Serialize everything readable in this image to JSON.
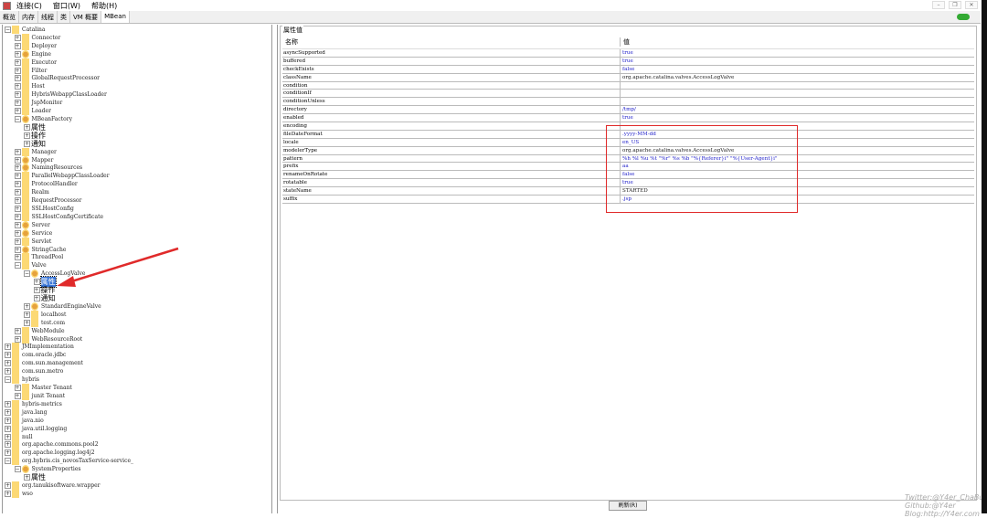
{
  "menu": {
    "items": [
      "连接(C)",
      "窗口(W)",
      "帮助(H)"
    ]
  },
  "window_controls": [
    "minimize",
    "restore",
    "close"
  ],
  "tabs": [
    {
      "label": "概览"
    },
    {
      "label": "内存"
    },
    {
      "label": "线程"
    },
    {
      "label": "类"
    },
    {
      "label": "VM 概要"
    },
    {
      "label": "MBean",
      "active": true
    }
  ],
  "tree": [
    [
      "Catalina",
      0,
      "-",
      "folder"
    ],
    [
      "Connector",
      1,
      "+",
      "folder"
    ],
    [
      "Deployer",
      1,
      "+",
      "folder"
    ],
    [
      "Engine",
      1,
      "+",
      "bean"
    ],
    [
      "Executor",
      1,
      "+",
      "folder"
    ],
    [
      "Filter",
      1,
      "+",
      "folder"
    ],
    [
      "GlobalRequestProcessor",
      1,
      "+",
      "folder"
    ],
    [
      "Host",
      1,
      "+",
      "folder"
    ],
    [
      "HybrisWebappClassLoader",
      1,
      "+",
      "folder"
    ],
    [
      "JspMonitor",
      1,
      "+",
      "folder"
    ],
    [
      "Loader",
      1,
      "+",
      "folder"
    ],
    [
      "MBeanFactory",
      1,
      "-",
      "bean"
    ],
    [
      "属性",
      2,
      "+",
      "none"
    ],
    [
      "操作",
      2,
      "+",
      "none"
    ],
    [
      "通知",
      2,
      "+",
      "none"
    ],
    [
      "Manager",
      1,
      "+",
      "folder"
    ],
    [
      "Mapper",
      1,
      "+",
      "bean"
    ],
    [
      "NamingResources",
      1,
      "+",
      "bean"
    ],
    [
      "ParallelWebappClassLoader",
      1,
      "+",
      "folder"
    ],
    [
      "ProtocolHandler",
      1,
      "+",
      "folder"
    ],
    [
      "Realm",
      1,
      "+",
      "folder"
    ],
    [
      "RequestProcessor",
      1,
      "+",
      "folder"
    ],
    [
      "SSLHostConfig",
      1,
      "+",
      "folder"
    ],
    [
      "SSLHostConfigCertificate",
      1,
      "+",
      "folder"
    ],
    [
      "Server",
      1,
      "+",
      "bean"
    ],
    [
      "Service",
      1,
      "+",
      "bean"
    ],
    [
      "Servlet",
      1,
      "+",
      "folder"
    ],
    [
      "StringCache",
      1,
      "+",
      "bean"
    ],
    [
      "ThreadPool",
      1,
      "+",
      "folder"
    ],
    [
      "Valve",
      1,
      "-",
      "folder"
    ],
    [
      "AccessLogValve",
      2,
      "-",
      "bean"
    ],
    [
      "属性",
      3,
      "+",
      "none",
      "selected"
    ],
    [
      "操作",
      3,
      "+",
      "none"
    ],
    [
      "通知",
      3,
      "+",
      "none"
    ],
    [
      "StandardEngineValve",
      2,
      "+",
      "bean"
    ],
    [
      "localhost",
      2,
      "+",
      "folder"
    ],
    [
      "test.com",
      2,
      "+",
      "folder"
    ],
    [
      "WebModule",
      1,
      "+",
      "folder"
    ],
    [
      "WebResourceRoot",
      1,
      "+",
      "folder"
    ],
    [
      "JMImplementation",
      0,
      "+",
      "folder"
    ],
    [
      "com.oracle.jdbc",
      0,
      "+",
      "folder"
    ],
    [
      "com.sun.management",
      0,
      "+",
      "folder"
    ],
    [
      "com.sun.metro",
      0,
      "+",
      "folder"
    ],
    [
      "hybris",
      0,
      "-",
      "folder"
    ],
    [
      "Master Tenant",
      1,
      "+",
      "folder"
    ],
    [
      "junit Tenant",
      1,
      "+",
      "folder"
    ],
    [
      "hybris-metrics",
      0,
      "+",
      "folder"
    ],
    [
      "java.lang",
      0,
      "+",
      "folder"
    ],
    [
      "java.nio",
      0,
      "+",
      "folder"
    ],
    [
      "java.util.logging",
      0,
      "+",
      "folder"
    ],
    [
      "null",
      0,
      "+",
      "folder"
    ],
    [
      "org.apache.commons.pool2",
      0,
      "+",
      "folder"
    ],
    [
      "org.apache.logging.log4j2",
      0,
      "+",
      "folder"
    ],
    [
      "org.hybris.cis_novosTaxService-service_",
      0,
      "-",
      "folder"
    ],
    [
      "SystemProperties",
      1,
      "-",
      "bean"
    ],
    [
      "属性",
      2,
      "+",
      "none"
    ],
    [
      "org.tanukisoftware.wrapper",
      0,
      "+",
      "folder"
    ],
    [
      "wso",
      0,
      "+",
      "folder"
    ]
  ],
  "attributes": {
    "group_title": "属性值",
    "headers": {
      "name": "名称",
      "value": "值"
    },
    "rows": [
      {
        "name": "asyncSupported",
        "value": "true"
      },
      {
        "name": "buffered",
        "value": "true"
      },
      {
        "name": "checkExists",
        "value": "false"
      },
      {
        "name": "className",
        "value": "org.apache.catalina.valves.AccessLogValve",
        "plain": true
      },
      {
        "name": "condition",
        "value": ""
      },
      {
        "name": "conditionIf",
        "value": ""
      },
      {
        "name": "conditionUnless",
        "value": ""
      },
      {
        "name": "directory",
        "value": "/tmp/"
      },
      {
        "name": "enabled",
        "value": "true"
      },
      {
        "name": "encoding",
        "value": ""
      },
      {
        "name": "fileDateFormat",
        "value": ".yyyy-MM-dd"
      },
      {
        "name": "locale",
        "value": "en_US"
      },
      {
        "name": "modelerType",
        "value": "org.apache.catalina.valves.AccessLogValve",
        "plain": true
      },
      {
        "name": "pattern",
        "value": "%h %l %u %t \"%r\" %s %b \"%{Referer}i\" \"%{User-Agent}i\""
      },
      {
        "name": "prefix",
        "value": "aa"
      },
      {
        "name": "renameOnRotate",
        "value": "false"
      },
      {
        "name": "rotatable",
        "value": "true"
      },
      {
        "name": "stateName",
        "value": "STARTED",
        "plain": true
      },
      {
        "name": "suffix",
        "value": ".jsp"
      }
    ]
  },
  "refresh_button": "刷新(R)",
  "watermark": [
    "Twitter:@Y4er_ChaBug",
    "Github:@Y4er",
    "Blog:http://Y4er.com"
  ],
  "colors": {
    "annotation": "#e02a2a",
    "value_text": "#1a1ac8",
    "selection": "#3875d7"
  }
}
